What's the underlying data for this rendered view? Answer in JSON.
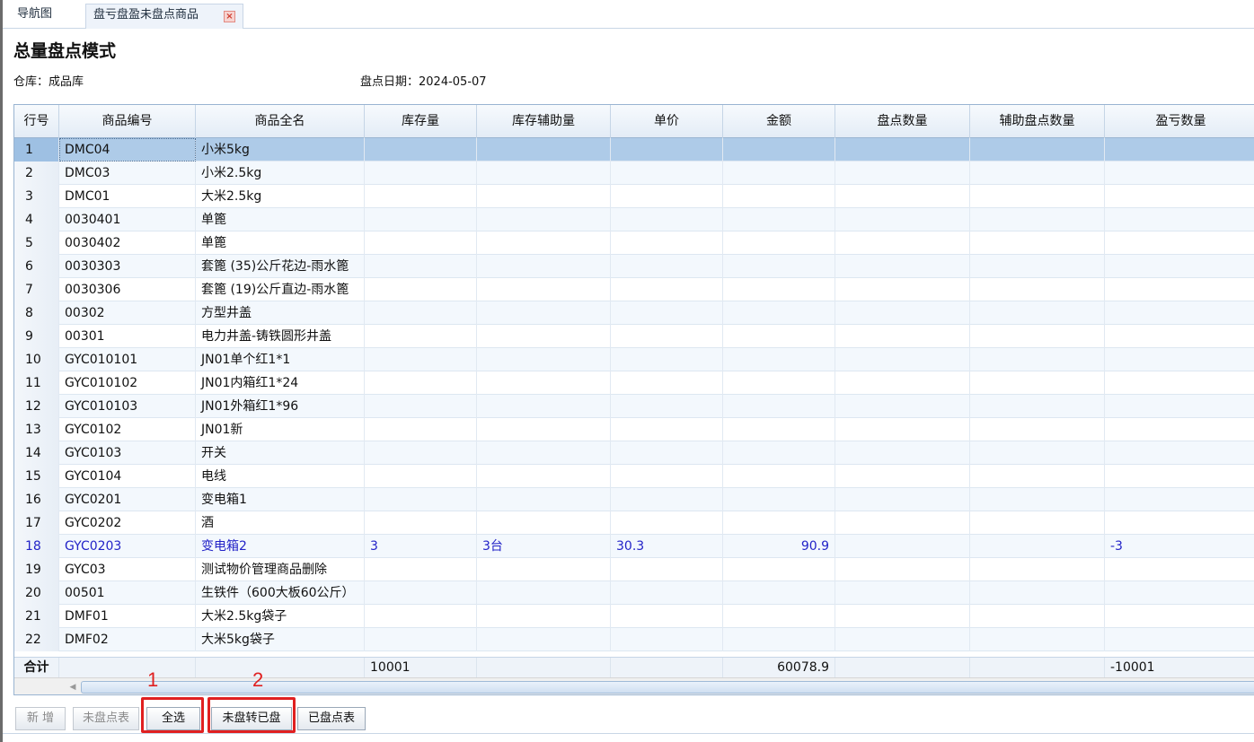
{
  "tabs": [
    {
      "label": "导航图"
    },
    {
      "label": "盘亏盘盈未盘点商品"
    }
  ],
  "close_glyph": "×",
  "page_title": "总量盘点模式",
  "warehouse": "仓库：成品库",
  "date": "盘点日期：2024-05-07",
  "columns": [
    "行号",
    "商品编号",
    "商品全名",
    "库存量",
    "库存辅助量",
    "单价",
    "金额",
    "盘点数量",
    "辅助盘点数量",
    "盈亏数量"
  ],
  "rows": [
    {
      "no": "1",
      "code": "DMC04",
      "name": "小米5kg",
      "qty": "",
      "aux": "",
      "price": "",
      "amount": "",
      "count": "",
      "aux_count": "",
      "diff": ""
    },
    {
      "no": "2",
      "code": "DMC03",
      "name": "小米2.5kg",
      "qty": "",
      "aux": "",
      "price": "",
      "amount": "",
      "count": "",
      "aux_count": "",
      "diff": ""
    },
    {
      "no": "3",
      "code": "DMC01",
      "name": "大米2.5kg",
      "qty": "",
      "aux": "",
      "price": "",
      "amount": "",
      "count": "",
      "aux_count": "",
      "diff": ""
    },
    {
      "no": "4",
      "code": "0030401",
      "name": "单篦",
      "qty": "",
      "aux": "",
      "price": "",
      "amount": "",
      "count": "",
      "aux_count": "",
      "diff": ""
    },
    {
      "no": "5",
      "code": "0030402",
      "name": "单篦",
      "qty": "",
      "aux": "",
      "price": "",
      "amount": "",
      "count": "",
      "aux_count": "",
      "diff": ""
    },
    {
      "no": "6",
      "code": "0030303",
      "name": "套篦 (35)公斤花边-雨水篦",
      "qty": "",
      "aux": "",
      "price": "",
      "amount": "",
      "count": "",
      "aux_count": "",
      "diff": ""
    },
    {
      "no": "7",
      "code": "0030306",
      "name": "套篦 (19)公斤直边-雨水篦",
      "qty": "",
      "aux": "",
      "price": "",
      "amount": "",
      "count": "",
      "aux_count": "",
      "diff": ""
    },
    {
      "no": "8",
      "code": "00302",
      "name": "方型井盖",
      "qty": "",
      "aux": "",
      "price": "",
      "amount": "",
      "count": "",
      "aux_count": "",
      "diff": ""
    },
    {
      "no": "9",
      "code": "00301",
      "name": "电力井盖-铸铁圆形井盖",
      "qty": "",
      "aux": "",
      "price": "",
      "amount": "",
      "count": "",
      "aux_count": "",
      "diff": ""
    },
    {
      "no": "10",
      "code": "GYC010101",
      "name": "JN01单个红1*1",
      "qty": "",
      "aux": "",
      "price": "",
      "amount": "",
      "count": "",
      "aux_count": "",
      "diff": ""
    },
    {
      "no": "11",
      "code": "GYC010102",
      "name": "JN01内箱红1*24",
      "qty": "",
      "aux": "",
      "price": "",
      "amount": "",
      "count": "",
      "aux_count": "",
      "diff": ""
    },
    {
      "no": "12",
      "code": "GYC010103",
      "name": "JN01外箱红1*96",
      "qty": "",
      "aux": "",
      "price": "",
      "amount": "",
      "count": "",
      "aux_count": "",
      "diff": ""
    },
    {
      "no": "13",
      "code": "GYC0102",
      "name": "JN01新",
      "qty": "",
      "aux": "",
      "price": "",
      "amount": "",
      "count": "",
      "aux_count": "",
      "diff": ""
    },
    {
      "no": "14",
      "code": "GYC0103",
      "name": "开关",
      "qty": "",
      "aux": "",
      "price": "",
      "amount": "",
      "count": "",
      "aux_count": "",
      "diff": ""
    },
    {
      "no": "15",
      "code": "GYC0104",
      "name": "电线",
      "qty": "",
      "aux": "",
      "price": "",
      "amount": "",
      "count": "",
      "aux_count": "",
      "diff": ""
    },
    {
      "no": "16",
      "code": "GYC0201",
      "name": "变电箱1",
      "qty": "",
      "aux": "",
      "price": "",
      "amount": "",
      "count": "",
      "aux_count": "",
      "diff": ""
    },
    {
      "no": "17",
      "code": "GYC0202",
      "name": "酒",
      "qty": "",
      "aux": "",
      "price": "",
      "amount": "",
      "count": "",
      "aux_count": "",
      "diff": ""
    },
    {
      "no": "18",
      "code": "GYC0203",
      "name": "变电箱2",
      "qty": "3",
      "aux": "3台",
      "price": "30.3",
      "amount": "90.9",
      "count": "",
      "aux_count": "",
      "diff": "-3"
    },
    {
      "no": "19",
      "code": "GYC03",
      "name": "测试物价管理商品删除",
      "qty": "",
      "aux": "",
      "price": "",
      "amount": "",
      "count": "",
      "aux_count": "",
      "diff": ""
    },
    {
      "no": "20",
      "code": "00501",
      "name": "生铁件（600大板60公斤）",
      "qty": "",
      "aux": "",
      "price": "",
      "amount": "",
      "count": "",
      "aux_count": "",
      "diff": ""
    },
    {
      "no": "21",
      "code": "DMF01",
      "name": "大米2.5kg袋子",
      "qty": "",
      "aux": "",
      "price": "",
      "amount": "",
      "count": "",
      "aux_count": "",
      "diff": ""
    },
    {
      "no": "22",
      "code": "DMF02",
      "name": "大米5kg袋子",
      "qty": "",
      "aux": "",
      "price": "",
      "amount": "",
      "count": "",
      "aux_count": "",
      "diff": ""
    }
  ],
  "selected_row": 0,
  "highlighted_row": 17,
  "totals": {
    "label": "合计",
    "qty": "10001",
    "amount": "60078.9",
    "diff": "-10001"
  },
  "buttons": {
    "add": "新 增",
    "uncounted": "未盘点表",
    "select_all": "全选",
    "convert": "未盘转已盘",
    "counted": "已盘点表"
  },
  "annotations": {
    "first": "1",
    "second": "2"
  },
  "colors": {
    "highlight_text": "#2323c8",
    "selected_row": "#aecbe8",
    "marker": "#e02020"
  }
}
